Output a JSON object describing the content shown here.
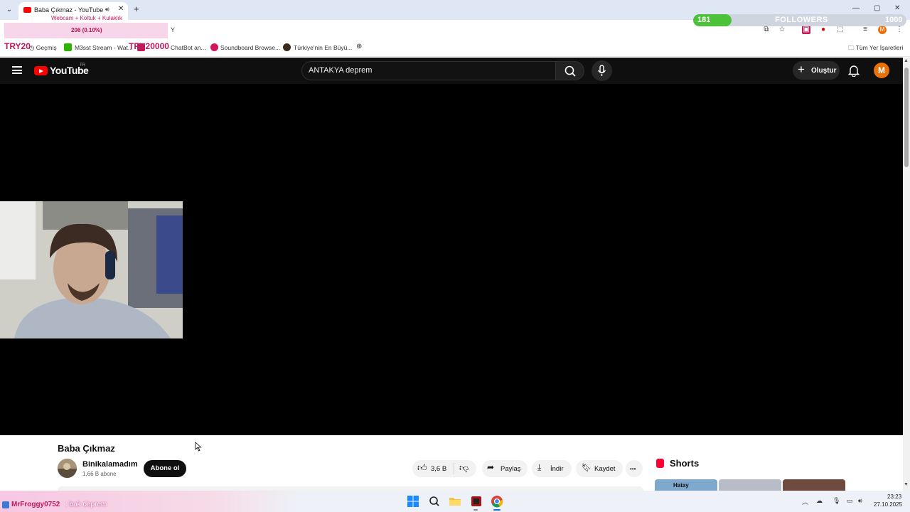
{
  "browser": {
    "tab_title": "Baba Çıkmaz - YouTube",
    "tab_audio_icon": "speaker-icon",
    "new_tab": "+",
    "window_controls": [
      "—",
      "▢",
      "✕"
    ],
    "address_overlay_text": "Y"
  },
  "stream_overlay": {
    "webcam_promo": "Webcam + Koltuk + Kulaklık",
    "donation_progress": "206 (0.10%)",
    "try_small": "TRY20",
    "try_large": "TRY20000",
    "followers_current": "181",
    "followers_label": "FOLLOWERS",
    "followers_goal": "1000",
    "followers_progress": 0.181,
    "chat_user": "MrFroggy0752",
    "chat_message": ": bak deprem"
  },
  "bookmarks": {
    "items": [
      {
        "label": "Geçmiş",
        "icon": "history-icon"
      },
      {
        "label": "M3sst Stream - Wat...",
        "icon": "m3-icon"
      },
      {
        "label": "ChatBot an...",
        "icon": "chatbot-icon"
      },
      {
        "label": "Soundboard Browse...",
        "icon": "soundboard-icon"
      },
      {
        "label": "Türkiye'nin En Büyü...",
        "icon": "bookmark-icon"
      }
    ],
    "all_bookmarks": "Tüm Yer İşaretleri"
  },
  "youtube": {
    "logo_text": "YouTube",
    "region": "TR",
    "search_value": "ANTAKYA deprem",
    "create_label": "Oluştur",
    "avatar_letter": "M",
    "video": {
      "title": "Baba Çıkmaz",
      "channel_name": "Binikalamadım",
      "subscribers": "1,66 B abone",
      "subscribe_label": "Abone ol",
      "likes": "3,6 B",
      "share_label": "Paylaş",
      "download_label": "İndir",
      "save_label": "Kaydet",
      "more_label": "•••"
    },
    "shorts_label": "Shorts",
    "shorts_thumb_text": "Hatay"
  },
  "taskbar": {
    "time": "23:23",
    "date": "27.10.2025"
  },
  "colors": {
    "yt_red": "#ff0000",
    "overlay_pink": "#c0195c",
    "followers_green": "#4cc23a"
  }
}
